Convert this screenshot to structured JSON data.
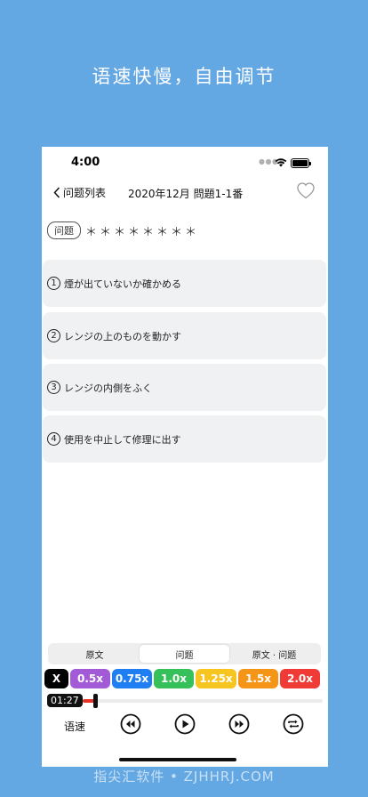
{
  "promo": {
    "title": "语速快慢，自由调节"
  },
  "status": {
    "time": "4:00"
  },
  "nav": {
    "back_label": "问题列表",
    "title": "2020年12月 問題1-1番"
  },
  "question": {
    "tag": "问题",
    "masked_text": "＊＊＊＊＊＊＊＊"
  },
  "options": [
    {
      "num": "1",
      "text": "煙が出ていないか確かめる"
    },
    {
      "num": "2",
      "text": "レンジの上のものを動かす"
    },
    {
      "num": "3",
      "text": "レンジの内側をふく"
    },
    {
      "num": "4",
      "text": "使用を中止して修理に出す"
    }
  ],
  "tabs": [
    {
      "label": "原文",
      "active": false
    },
    {
      "label": "问题",
      "active": true
    },
    {
      "label": "原文 · 问题",
      "active": false
    }
  ],
  "speeds": [
    {
      "label": "X",
      "color": "#000000"
    },
    {
      "label": "0.5x",
      "color": "#a35ad6"
    },
    {
      "label": "0.75x",
      "color": "#1e7ef2"
    },
    {
      "label": "1.0x",
      "color": "#36c05a"
    },
    {
      "label": "1.25x",
      "color": "#f7c520"
    },
    {
      "label": "1.5x",
      "color": "#f59518"
    },
    {
      "label": "2.0x",
      "color": "#ef3a35"
    }
  ],
  "player": {
    "current_time": "01:27",
    "progress": 0.04
  },
  "controls": {
    "speed_label": "语速"
  },
  "watermark": {
    "text": "指尖汇软件 • ZJHHRJ.COM"
  }
}
